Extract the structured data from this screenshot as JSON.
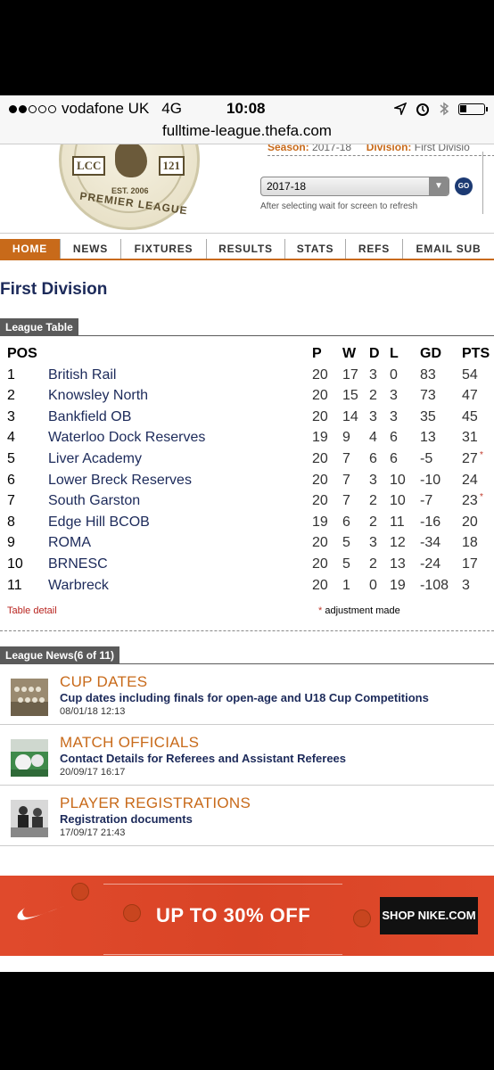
{
  "status_bar": {
    "carrier": "vodafone UK",
    "network": "4G",
    "time": "10:08"
  },
  "url_bar": {
    "url": "fulltime-league.thefa.com"
  },
  "header": {
    "logo": {
      "left_text": "LCC",
      "right_text": "121",
      "est": "EST. 2006",
      "league_text": "PREMIER LEAGUE"
    },
    "season_label": "Season:",
    "season_value": "2017-18",
    "division_label": "Division:",
    "division_value": "First Divisio",
    "season_select": {
      "selected": "2017-18",
      "go_label": "GO",
      "hint": "After selecting wait for screen to refresh"
    }
  },
  "nav": {
    "items": [
      {
        "label": "HOME",
        "active": true
      },
      {
        "label": "NEWS"
      },
      {
        "label": "FIXTURES"
      },
      {
        "label": "RESULTS"
      },
      {
        "label": "STATS"
      },
      {
        "label": "REFS"
      },
      {
        "label": "EMAIL SUB"
      }
    ]
  },
  "page_title": "First Division",
  "league_table": {
    "tab_label": "League Table",
    "headers": {
      "pos": "POS",
      "p": "P",
      "w": "W",
      "d": "D",
      "l": "L",
      "gd": "GD",
      "pts": "PTS"
    },
    "rows": [
      {
        "pos": "1",
        "team": "British Rail",
        "p": "20",
        "w": "17",
        "d": "3",
        "l": "0",
        "gd": "83",
        "pts": "54",
        "adj": ""
      },
      {
        "pos": "2",
        "team": "Knowsley North",
        "p": "20",
        "w": "15",
        "d": "2",
        "l": "3",
        "gd": "73",
        "pts": "47",
        "adj": ""
      },
      {
        "pos": "3",
        "team": "Bankfield OB",
        "p": "20",
        "w": "14",
        "d": "3",
        "l": "3",
        "gd": "35",
        "pts": "45",
        "adj": ""
      },
      {
        "pos": "4",
        "team": "Waterloo Dock Reserves",
        "p": "19",
        "w": "9",
        "d": "4",
        "l": "6",
        "gd": "13",
        "pts": "31",
        "adj": ""
      },
      {
        "pos": "5",
        "team": "Liver Academy",
        "p": "20",
        "w": "7",
        "d": "6",
        "l": "6",
        "gd": "-5",
        "pts": "27",
        "adj": "*"
      },
      {
        "pos": "6",
        "team": "Lower Breck Reserves",
        "p": "20",
        "w": "7",
        "d": "3",
        "l": "10",
        "gd": "-10",
        "pts": "24",
        "adj": ""
      },
      {
        "pos": "7",
        "team": "South Garston",
        "p": "20",
        "w": "7",
        "d": "2",
        "l": "10",
        "gd": "-7",
        "pts": "23",
        "adj": "*"
      },
      {
        "pos": "8",
        "team": "Edge Hill BCOB",
        "p": "19",
        "w": "6",
        "d": "2",
        "l": "11",
        "gd": "-16",
        "pts": "20",
        "adj": ""
      },
      {
        "pos": "9",
        "team": "ROMA",
        "p": "20",
        "w": "5",
        "d": "3",
        "l": "12",
        "gd": "-34",
        "pts": "18",
        "adj": ""
      },
      {
        "pos": "10",
        "team": "BRNESC",
        "p": "20",
        "w": "5",
        "d": "2",
        "l": "13",
        "gd": "-24",
        "pts": "17",
        "adj": ""
      },
      {
        "pos": "11",
        "team": "Warbreck",
        "p": "20",
        "w": "1",
        "d": "0",
        "l": "19",
        "gd": "-108",
        "pts": "3",
        "adj": ""
      }
    ],
    "detail_link": "Table detail",
    "adjustment_star": "*",
    "adjustment_note": "adjustment made"
  },
  "league_news": {
    "tab_label": "League News(6 of 11)",
    "items": [
      {
        "category": "CUP DATES",
        "headline": "Cup dates including finals for open-age and U18 Cup Competitions",
        "date": "08/01/18 12:13",
        "thumb_icon": "team-photo-icon"
      },
      {
        "category": "MATCH OFFICIALS",
        "headline": "Contact Details for Referees and Assistant Referees",
        "date": "20/09/17 16:17",
        "thumb_icon": "football-photo-icon"
      },
      {
        "category": "PLAYER REGISTRATIONS",
        "headline": "Registration documents",
        "date": "17/09/17 21:43",
        "thumb_icon": "registration-photo-icon"
      }
    ]
  },
  "ad": {
    "brand_icon": "nike-swoosh-icon",
    "offer": "UP TO 30% OFF",
    "cta": "SHOP NIKE.COM",
    "colors": {
      "background": "#e04a2c",
      "button": "#111111"
    }
  },
  "colors": {
    "accent": "#c86a1a",
    "navy": "#1c2a5a",
    "section_tab": "#5a5a5a",
    "link_red": "#b8241f"
  }
}
